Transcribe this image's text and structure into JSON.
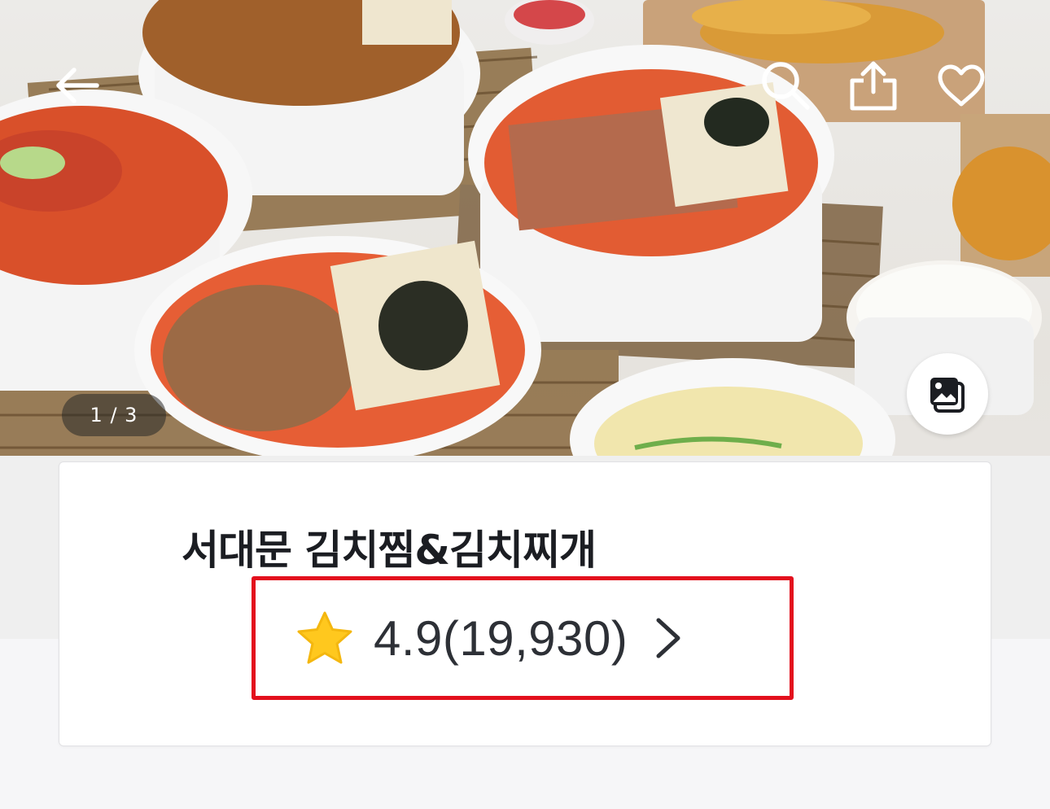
{
  "header": {
    "back_icon": "arrow-left-icon",
    "search_icon": "search-icon",
    "share_icon": "share-icon",
    "favorite_icon": "heart-outline-icon"
  },
  "gallery": {
    "counter": "1 / 3",
    "photo_button_icon": "photo-gallery-icon"
  },
  "store": {
    "name": "서대문 김치찜&김치찌개",
    "rating": "4.9(19,930)",
    "rating_icon": "star-icon",
    "rating_arrow_icon": "chevron-right-icon"
  },
  "colors": {
    "star": "#FFC81E",
    "highlight": "#E3101D",
    "text": "#1B1D22"
  }
}
